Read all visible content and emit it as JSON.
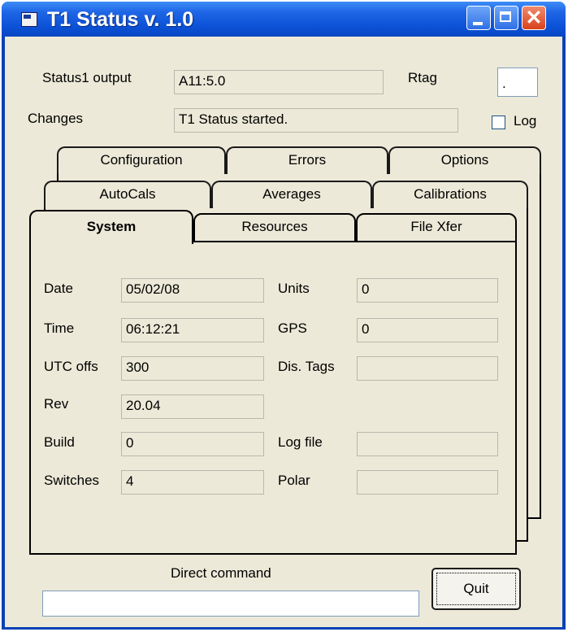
{
  "window": {
    "title": "T1 Status v. 1.0"
  },
  "top": {
    "status1_label": "Status1 output",
    "status1_value": "A11:5.0",
    "rtag_label": "Rtag",
    "rtag_value": ".",
    "changes_label": "Changes",
    "changes_value": "T1 Status started.",
    "log_label": "Log",
    "log_checked": false
  },
  "tabs": {
    "row1": [
      "Configuration",
      "Errors",
      "Options"
    ],
    "row2": [
      "AutoCals",
      "Averages",
      "Calibrations"
    ],
    "row3": [
      "System",
      "Resources",
      "File Xfer"
    ],
    "selected": "System"
  },
  "system": {
    "left": [
      {
        "label": "Date",
        "value": "05/02/08"
      },
      {
        "label": "Time",
        "value": "06:12:21"
      },
      {
        "label": "UTC offs",
        "value": "300"
      },
      {
        "label": "Rev",
        "value": "20.04"
      },
      {
        "label": "Build",
        "value": "0"
      },
      {
        "label": "Switches",
        "value": "4"
      }
    ],
    "right": [
      {
        "label": "Units",
        "value": "0"
      },
      {
        "label": "GPS",
        "value": "0"
      },
      {
        "label": "Dis. Tags",
        "value": ""
      },
      {
        "label": "Log file",
        "value": ""
      },
      {
        "label": "Polar",
        "value": ""
      }
    ]
  },
  "bottom": {
    "direct_command_label": "Direct command",
    "direct_command_value": "",
    "quit_label": "Quit"
  }
}
